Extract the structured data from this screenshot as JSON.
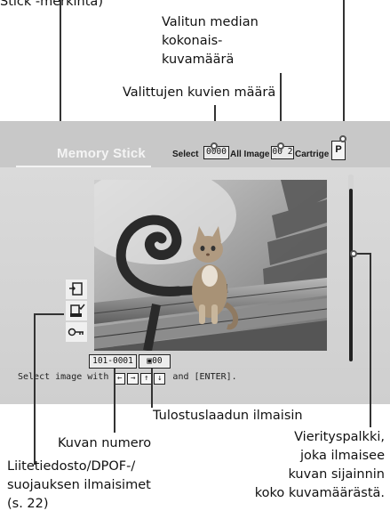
{
  "callouts": {
    "top_left_fragment": "Stick -merkintä)",
    "total_media_count_line1": "Valitun median",
    "total_media_count_line2": "kokonais-",
    "total_media_count_line3": "kuvamäärä",
    "selected_count": "Valittujen kuvien määrä",
    "print_quality": "Tulostuslaadun ilmaisin",
    "image_number": "Kuvan numero",
    "indicators_line1": "Liitetiedosto/DPOF-/",
    "indicators_line2": "suojauksen ilmaisimet",
    "indicators_line3": "(s. 22)",
    "scrollbar_line1": "Vierityspalkki,",
    "scrollbar_line2": "joka ilmaisee",
    "scrollbar_line3": "kuvan sijainnin",
    "scrollbar_line4": "koko kuvamäärästä."
  },
  "screen": {
    "media_label": "Memory Stick",
    "select_label": "Select",
    "select_count": "0000",
    "all_image_label": "All Image",
    "all_image_count": "00 2",
    "cartridge_label": "Cartrige",
    "cartridge_icon_letter": "P",
    "file_number": "101-0001",
    "quality_value": "00",
    "instruction_prefix": "Select image with",
    "instruction_suffix": "and [ENTER].",
    "arrow_keys": [
      "←",
      "→",
      "↑",
      "↓"
    ]
  },
  "side_icons": [
    "attachment-file-icon",
    "dpof-print-icon",
    "protect-key-icon"
  ]
}
